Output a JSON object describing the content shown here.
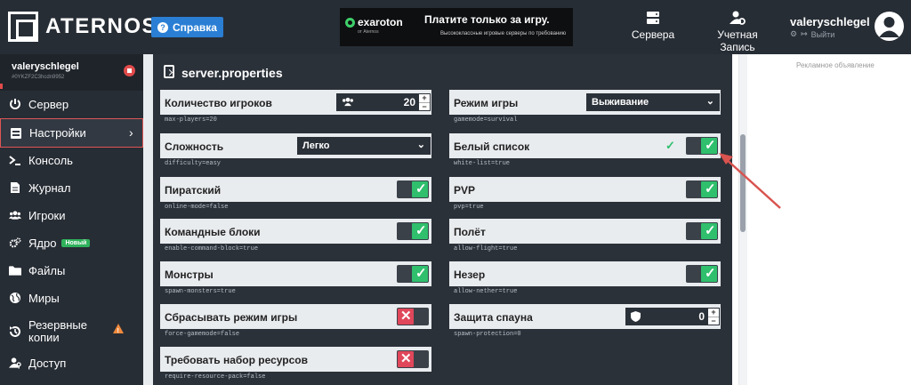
{
  "header": {
    "brand": "ATERNOS",
    "help_label": "Справка",
    "ad": {
      "logo_text": "exaroton",
      "logo_sub": "от Aternos",
      "headline": "Платите только за игру.",
      "subline": "Высококлассные игровые серверы по требованию"
    },
    "nav": [
      {
        "label": "Сервера",
        "icon": "servers-icon"
      },
      {
        "label": "Учетная Запись",
        "icon": "account-gear-icon"
      }
    ],
    "user": {
      "name": "valeryschlegel",
      "logout_label": "Выйти"
    }
  },
  "sidebar": {
    "user_name": "valeryschlegel",
    "user_id": "#0YKZF2C3hcdn9952",
    "items": [
      {
        "label": "Сервер",
        "icon": "power-icon"
      },
      {
        "label": "Настройки",
        "icon": "settings-icon",
        "active": true
      },
      {
        "label": "Консоль",
        "icon": "terminal-icon"
      },
      {
        "label": "Журнал",
        "icon": "log-file-icon"
      },
      {
        "label": "Игроки",
        "icon": "players-icon"
      },
      {
        "label": "Ядро",
        "icon": "gears-icon",
        "badge": "Новый"
      },
      {
        "label": "Файлы",
        "icon": "folder-icon"
      },
      {
        "label": "Миры",
        "icon": "globe-icon"
      },
      {
        "label": "Резервные копии",
        "icon": "history-icon",
        "warning": true
      },
      {
        "label": "Доступ",
        "icon": "user-key-icon"
      }
    ]
  },
  "panel": {
    "title": "server.properties",
    "left": [
      {
        "label": "Количество игроков",
        "key": "max-players=20",
        "type": "number",
        "value": "20"
      },
      {
        "label": "Сложность",
        "key": "difficulty=easy",
        "type": "select",
        "value": "Легко"
      },
      {
        "label": "Пиратский",
        "key": "online-mode=false",
        "type": "toggle",
        "on": true
      },
      {
        "label": "Командные блоки",
        "key": "enable-command-block=true",
        "type": "toggle",
        "on": true
      },
      {
        "label": "Монстры",
        "key": "spawn-monsters=true",
        "type": "toggle",
        "on": true
      },
      {
        "label": "Сбрасывать режим игры",
        "key": "force-gamemode=false",
        "type": "toggle",
        "on": false
      },
      {
        "label": "Требовать набор ресурсов",
        "key": "require-resource-pack=false",
        "type": "toggle",
        "on": false
      }
    ],
    "right": [
      {
        "label": "Режим игры",
        "key": "gamemode=survival",
        "type": "select",
        "value": "Выживание"
      },
      {
        "label": "Белый список",
        "key": "white-list=true",
        "type": "toggle",
        "on": true,
        "saved": true
      },
      {
        "label": "PVP",
        "key": "pvp=true",
        "type": "toggle",
        "on": true
      },
      {
        "label": "Полёт",
        "key": "allow-flight=true",
        "type": "toggle",
        "on": true
      },
      {
        "label": "Незер",
        "key": "allow-nether=true",
        "type": "toggle",
        "on": true
      },
      {
        "label": "Защита спауна",
        "key": "spawn-protection=0",
        "type": "number",
        "value": "0"
      }
    ]
  },
  "side_ad": {
    "label": "Рекламное объявление"
  },
  "glyphs": {
    "check": "✓",
    "cross": "✕",
    "chevron_right": "›",
    "chevron_down": "⌄",
    "plus": "+",
    "minus": "−"
  },
  "colors": {
    "topbar": "#272d35",
    "help": "#2a7fd4",
    "toggle_on": "#2fbf6d",
    "toggle_off": "#e0475a",
    "active_border": "#e05555",
    "annotation_arrow": "#d9534f"
  }
}
